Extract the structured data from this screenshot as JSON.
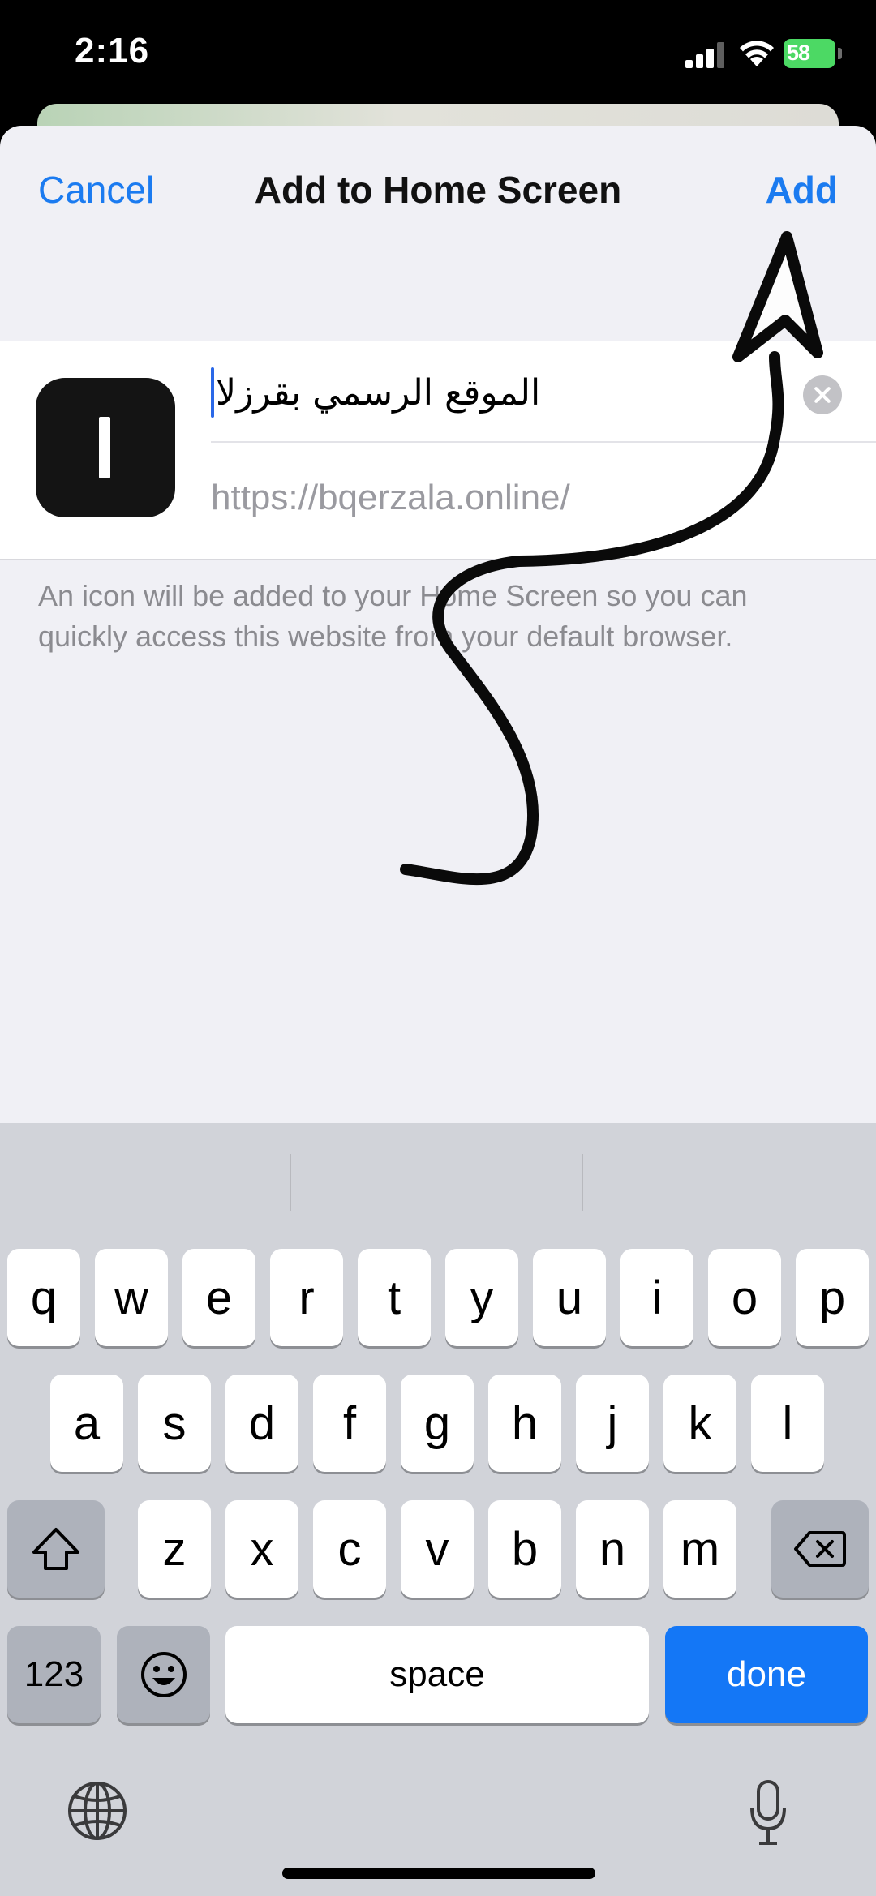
{
  "status_bar": {
    "time": "2:16",
    "battery": "58"
  },
  "nav": {
    "cancel": "Cancel",
    "title": "Add to Home Screen",
    "add": "Add"
  },
  "form": {
    "app_icon_letter": "I",
    "name_value": "الموقع الرسمي بقرزلا",
    "url": "https://bqerzala.online/"
  },
  "hint": "An icon will be added to your Home Screen so you can quickly access this website from your default browser.",
  "keyboard": {
    "row1": [
      "q",
      "w",
      "e",
      "r",
      "t",
      "y",
      "u",
      "i",
      "o",
      "p"
    ],
    "row2": [
      "a",
      "s",
      "d",
      "f",
      "g",
      "h",
      "j",
      "k",
      "l"
    ],
    "row3": [
      "z",
      "x",
      "c",
      "v",
      "b",
      "n",
      "m"
    ],
    "numbers": "123",
    "space": "space",
    "done": "done"
  },
  "colors": {
    "accent": "#1b7bf0",
    "done_key": "#1477f6",
    "keyboard_bg": "#d1d3d9",
    "sheet_bg": "#f0f0f5"
  }
}
